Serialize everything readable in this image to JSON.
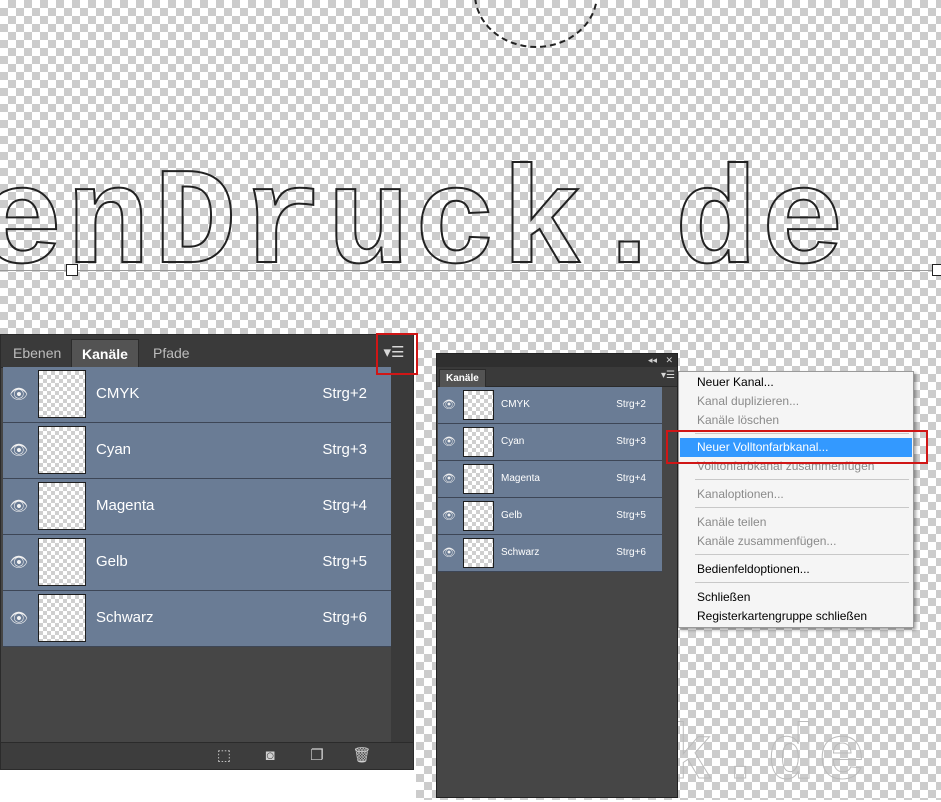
{
  "left_panel": {
    "tabs": [
      {
        "label": "Ebenen",
        "active": false
      },
      {
        "label": "Kanäle",
        "active": true
      },
      {
        "label": "Pfade",
        "active": false
      }
    ],
    "menu_icon": "panel-menu-icon",
    "channels": [
      {
        "name": "CMYK",
        "shortcut": "Strg+2"
      },
      {
        "name": "Cyan",
        "shortcut": "Strg+3"
      },
      {
        "name": "Magenta",
        "shortcut": "Strg+4"
      },
      {
        "name": "Gelb",
        "shortcut": "Strg+5"
      },
      {
        "name": "Schwarz",
        "shortcut": "Strg+6"
      }
    ],
    "bottom_icons": [
      "load-selection-icon",
      "save-selection-icon",
      "new-channel-icon",
      "delete-channel-icon"
    ]
  },
  "right_panel": {
    "tab": "Kanäle",
    "channels": [
      {
        "name": "CMYK",
        "shortcut": "Strg+2"
      },
      {
        "name": "Cyan",
        "shortcut": "Strg+3"
      },
      {
        "name": "Magenta",
        "shortcut": "Strg+4"
      },
      {
        "name": "Gelb",
        "shortcut": "Strg+5"
      },
      {
        "name": "Schwarz",
        "shortcut": "Strg+6"
      }
    ]
  },
  "context_menu": {
    "items": [
      {
        "label": "Neuer Kanal...",
        "disabled": false
      },
      {
        "label": "Kanal duplizieren...",
        "disabled": true
      },
      {
        "label": "Kanäle löschen",
        "disabled": true
      },
      {
        "label": "Neuer Volltonfarbkanal...",
        "disabled": false,
        "highlighted": true
      },
      {
        "label": "Volltonfarbkanal zusammenfügen",
        "disabled": true
      },
      {
        "label": "Kanaloptionen...",
        "disabled": true
      },
      {
        "label": "Kanäle teilen",
        "disabled": true
      },
      {
        "label": "Kanäle zusammenfügen...",
        "disabled": true
      },
      {
        "label": "Bedienfeldoptionen...",
        "disabled": false
      },
      {
        "label": "Schließen",
        "disabled": false
      },
      {
        "label": "Registerkartengruppe schließen",
        "disabled": false
      }
    ]
  },
  "colors": {
    "highlight": "#3399ff",
    "callout": "#d01616",
    "channel_row": "#6a7c95"
  }
}
